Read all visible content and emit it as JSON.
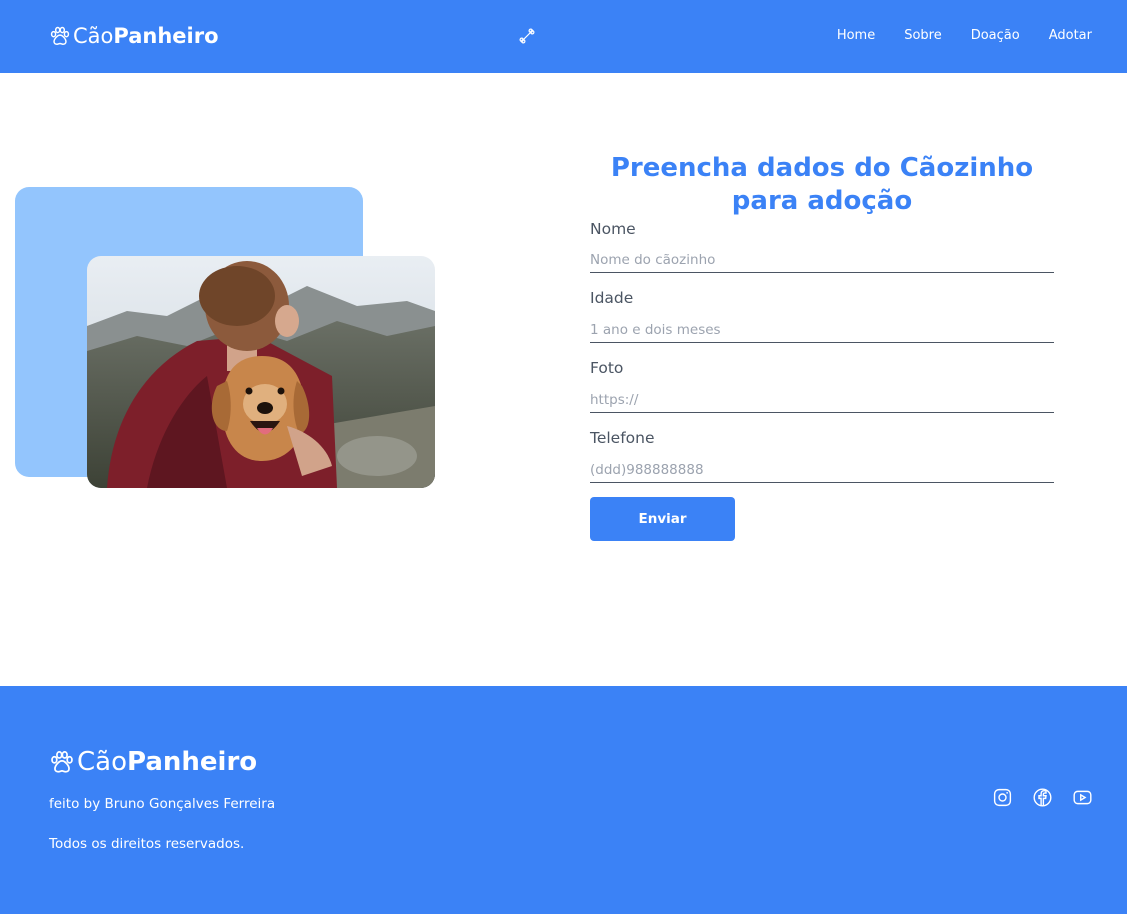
{
  "brand": {
    "regular": "Cão",
    "bold": "Panheiro"
  },
  "header": {
    "theme_toggle_icon": "bone-icon",
    "nav": [
      "Home",
      "Sobre",
      "Doação",
      "Adotar"
    ]
  },
  "colors": {
    "primary": "#3b82f6",
    "accent_light": "#93c5fd",
    "text": "#4b5563"
  },
  "form": {
    "title": "Preencha dados do Cãozinho para adoção",
    "fields": [
      {
        "label": "Nome",
        "placeholder": "Nome do cãozinho"
      },
      {
        "label": "Idade",
        "placeholder": "1 ano e dois meses"
      },
      {
        "label": "Foto",
        "placeholder": "https://"
      },
      {
        "label": "Telefone",
        "placeholder": "(ddd)988888888"
      }
    ],
    "submit_label": "Enviar"
  },
  "footer": {
    "credit": "feito by Bruno Gonçalves Ferreira",
    "rights": "Todos os direitos reservados.",
    "socials": [
      "instagram-icon",
      "facebook-icon",
      "youtube-icon"
    ]
  }
}
